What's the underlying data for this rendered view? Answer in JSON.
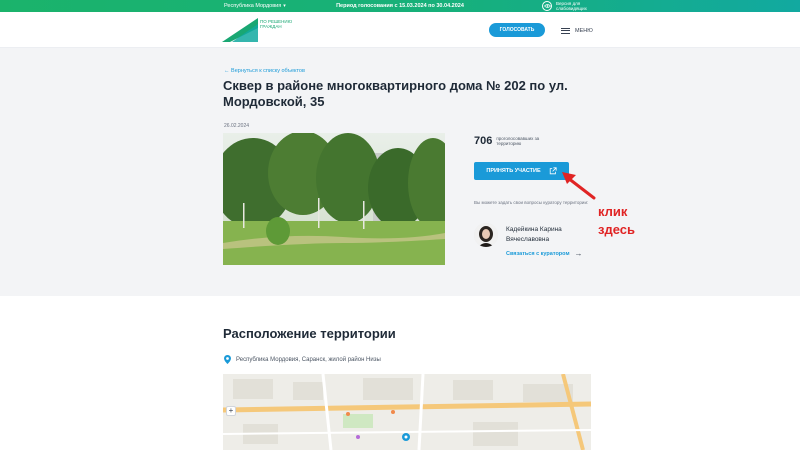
{
  "topbar": {
    "region": "Республика Мордовия",
    "period": "Период голосования с 15.03.2024 по 30.04.2024",
    "accessibility": "Версия для слабовидящих"
  },
  "header": {
    "logo_text": "ПО РЕШЕНИЮ ГРАЖДАН",
    "vote_label": "ГОЛОСОВАТЬ",
    "menu_label": "МЕНЮ"
  },
  "object": {
    "back_link": "Вернуться к списку объектов",
    "title": "Сквер в районе многоквартирного дома № 202 по ул. Мордовской, 35",
    "date": "26.02.2024",
    "count": "706",
    "count_label": "проголосовавших за территорию",
    "join_label": "ПРИНЯТЬ УЧАСТИЕ",
    "curator_hint": "Вы можете задать свои вопросы куратору территории:",
    "curator_name": "Кадейкина Карина Вячеславовна",
    "curator_contact": "Связаться с куратором"
  },
  "annotation": {
    "line1": "клик",
    "line2": "здесь"
  },
  "location": {
    "title": "Расположение территории",
    "address": "Республика Мордовия, Саранск, жилой район Низы",
    "zoom_in": "+"
  },
  "colors": {
    "brand_green": "#1bb36b",
    "accent_blue": "#1a9ad8",
    "annotation_red": "#e02424"
  }
}
